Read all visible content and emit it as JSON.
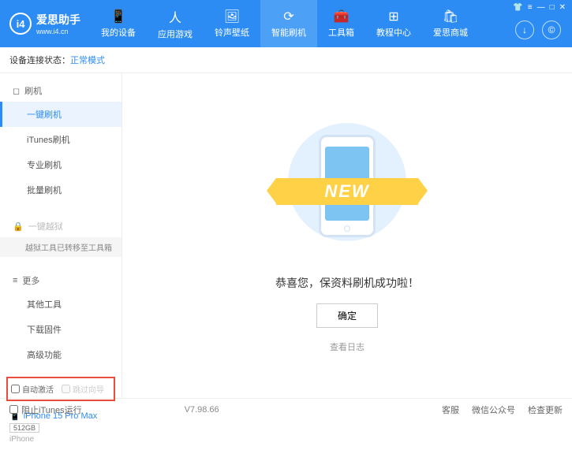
{
  "header": {
    "logo_text": "爱思助手",
    "logo_url": "www.i4.cn",
    "nav": [
      {
        "label": "我的设备",
        "icon": "📱"
      },
      {
        "label": "应用游戏",
        "icon": "人"
      },
      {
        "label": "铃声壁纸",
        "icon": "🖼"
      },
      {
        "label": "智能刷机",
        "icon": "⟳"
      },
      {
        "label": "工具箱",
        "icon": "🧰"
      },
      {
        "label": "教程中心",
        "icon": "⊞"
      },
      {
        "label": "爱思商城",
        "icon": "🛍"
      }
    ]
  },
  "status": {
    "label": "设备连接状态：",
    "value": "正常模式"
  },
  "sidebar": {
    "flash_heading": "刷机",
    "flash_items": [
      "一键刷机",
      "iTunes刷机",
      "专业刷机",
      "批量刷机"
    ],
    "jailbreak_heading": "一键越狱",
    "jailbreak_note": "越狱工具已转移至工具箱",
    "more_heading": "更多",
    "more_items": [
      "其他工具",
      "下载固件",
      "高级功能"
    ],
    "cb_auto_activate": "自动激活",
    "cb_skip_guide": "跳过向导"
  },
  "device": {
    "name": "iPhone 15 Pro Max",
    "storage": "512GB",
    "type": "iPhone"
  },
  "main": {
    "banner": "NEW",
    "success": "恭喜您，保资料刷机成功啦！",
    "confirm": "确定",
    "view_log": "查看日志"
  },
  "footer": {
    "block_itunes": "阻止iTunes运行",
    "version": "V7.98.66",
    "links": [
      "客服",
      "微信公众号",
      "检查更新"
    ]
  }
}
